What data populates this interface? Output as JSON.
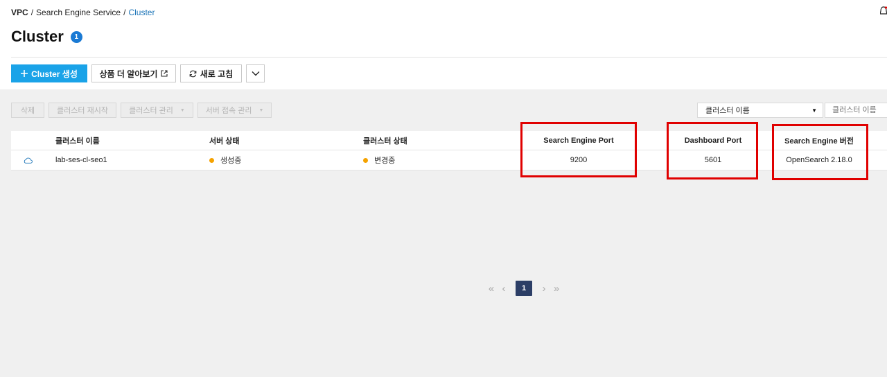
{
  "breadcrumb": {
    "items": [
      "VPC",
      "Search Engine Service",
      "Cluster"
    ],
    "separator": "/"
  },
  "page": {
    "title": "Cluster",
    "count": "1"
  },
  "toolbar": {
    "create_label": "Cluster 생성",
    "learn_more_label": "상품 더 알아보기",
    "refresh_label": "새로 고침"
  },
  "actions": {
    "delete_label": "삭제",
    "restart_label": "클러스터 재시작",
    "manage_label": "클러스터 관리",
    "access_label": "서버 접속 관리"
  },
  "filter": {
    "select_value": "클러스터 이름",
    "input_placeholder": "클러스터 이름"
  },
  "table": {
    "headers": {
      "name": "클러스터 이름",
      "server_status": "서버 상태",
      "cluster_status": "클러스터 상태",
      "port": "Search Engine Port",
      "dashboard_port": "Dashboard Port",
      "version": "Search Engine 버전"
    },
    "rows": [
      {
        "name": "lab-ses-cl-seo1",
        "server_status": "생성중",
        "cluster_status": "변경중",
        "port": "9200",
        "dashboard_port": "5601",
        "version": "OpenSearch 2.18.0",
        "status_color": "#f5a200"
      }
    ]
  },
  "pagination": {
    "current": "1"
  },
  "colors": {
    "primary": "#1aa3e8",
    "breadcrumb_active": "#1a73b7",
    "highlight": "#e00000",
    "page_active": "#2c3e66"
  }
}
